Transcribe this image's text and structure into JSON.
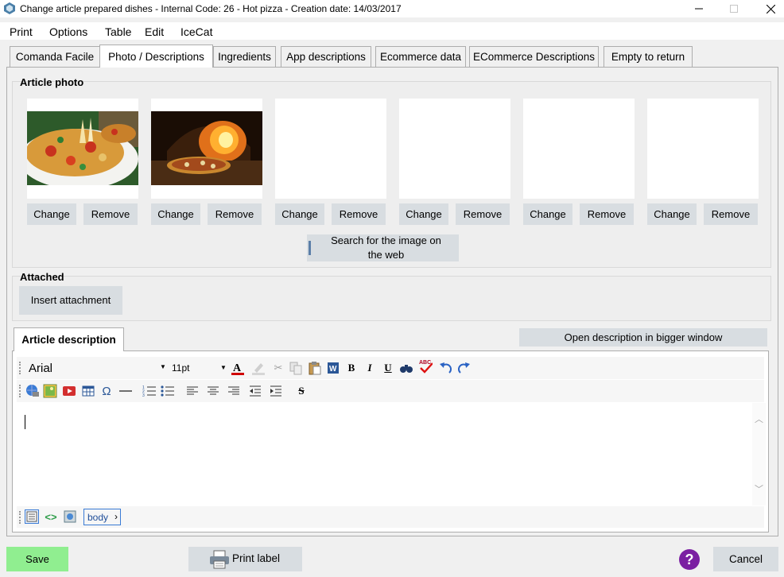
{
  "window": {
    "title": "Change article prepared dishes - Internal Code: 26 - Hot pizza - Creation date: 14/03/2017",
    "minimize_icon": "minimize-icon",
    "maximize_icon": "maximize-icon",
    "close_icon": "close-icon"
  },
  "menu": [
    "Print",
    "Options",
    "Table",
    "Edit",
    "IceCat"
  ],
  "tabs": [
    {
      "label": "Comanda Facile",
      "active": false
    },
    {
      "label": "Photo / Descriptions",
      "active": true
    },
    {
      "label": "Ingredients",
      "active": false
    },
    {
      "label": "App descriptions",
      "active": false
    },
    {
      "label": "Ecommerce data",
      "active": false
    },
    {
      "label": "ECommerce Descriptions",
      "active": false
    },
    {
      "label": "Empty to return",
      "active": false
    }
  ],
  "photo_section": {
    "title": "Article photo",
    "change_label": "Change",
    "remove_label": "Remove",
    "search_web_label": "Search for the image on the web",
    "slots": [
      {
        "has_image": true,
        "image": "pizza slice photo"
      },
      {
        "has_image": true,
        "image": "pizza in wood oven photo"
      },
      {
        "has_image": false
      },
      {
        "has_image": false
      },
      {
        "has_image": false
      },
      {
        "has_image": false
      }
    ]
  },
  "attached": {
    "title": "Attached",
    "insert_label": "Insert attachment"
  },
  "description": {
    "tab_label": "Article description",
    "open_bigger_label": "Open description in bigger window",
    "font_name": "Arial",
    "font_size": "11pt",
    "body_tag": "body",
    "content": ""
  },
  "footer": {
    "save_label": "Save",
    "print_label": "Print label",
    "help_icon": "?",
    "cancel_label": "Cancel"
  },
  "colors": {
    "save_bg": "#90ee90",
    "button_bg": "#d8dde1",
    "help_bg": "#7b1fa2"
  }
}
